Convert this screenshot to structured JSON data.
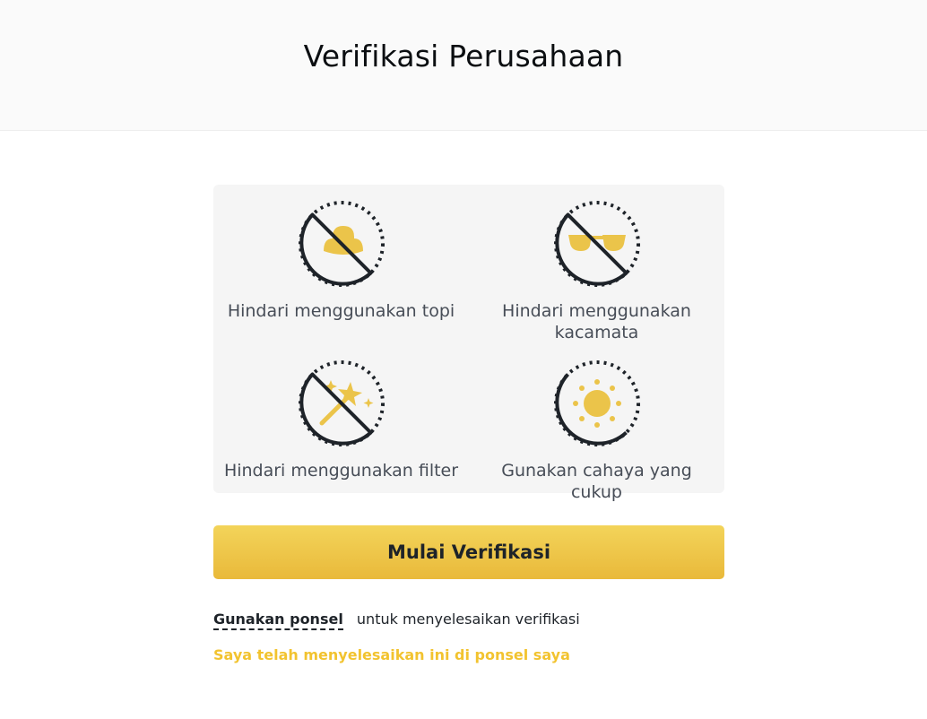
{
  "header": {
    "title": "Verifikasi Perusahaan"
  },
  "tips": [
    {
      "label": "Hindari menggunakan topi",
      "icon": "no-hat-icon"
    },
    {
      "label": "Hindari menggunakan kacamata",
      "icon": "no-glasses-icon"
    },
    {
      "label": "Hindari menggunakan filter",
      "icon": "no-filter-icon"
    },
    {
      "label": "Gunakan cahaya yang cukup",
      "icon": "sun-icon"
    }
  ],
  "actions": {
    "start_label": "Mulai Verifikasi",
    "phone_link_label": "Gunakan ponsel",
    "phone_suffix": "untuk menyelesaikan verifikasi",
    "done_link_label": "Saya telah menyelesaikan ini di ponsel saya"
  },
  "colors": {
    "accent": "#F0B90B",
    "icon_fill": "#EBC44A",
    "dark": "#1E2329",
    "panel_bg": "#F5F5F5",
    "header_bg": "#FAFAFA"
  }
}
